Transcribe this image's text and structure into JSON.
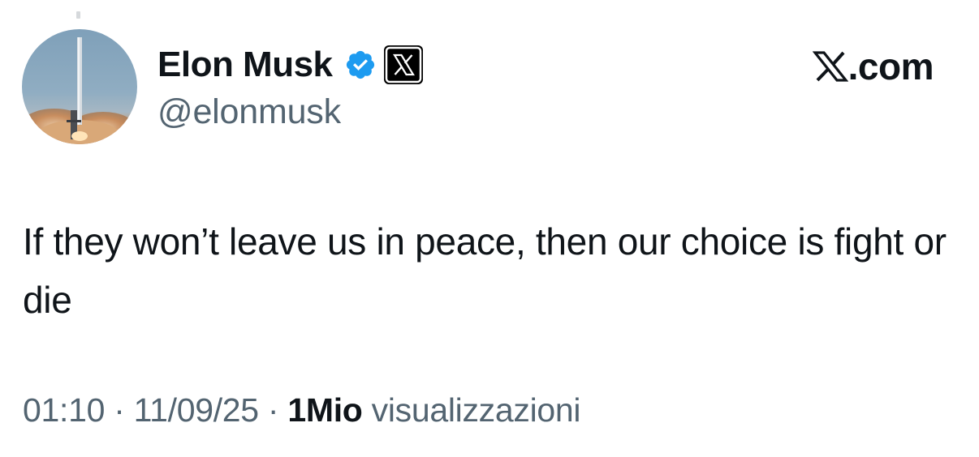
{
  "author": {
    "display_name": "Elon Musk",
    "handle": "@elonmusk",
    "avatar_icon": "rocket-launch-avatar",
    "verified_icon": "verified-badge-icon",
    "affiliation_icon": "x-logo-icon"
  },
  "brand": {
    "icon": "x-logo-icon",
    "label": ".com"
  },
  "tweet": {
    "text": "If they won’t leave us in peace, then our choice is fight or die"
  },
  "meta": {
    "time": "01:10",
    "separator1": " · ",
    "date": "11/09/25",
    "separator2": " · ",
    "views_count": "1Mio",
    "views_label": " visualizzazioni"
  },
  "colors": {
    "text_primary": "#0f1419",
    "text_secondary": "#536471",
    "verified_blue": "#1d9bf0",
    "background": "#ffffff"
  }
}
